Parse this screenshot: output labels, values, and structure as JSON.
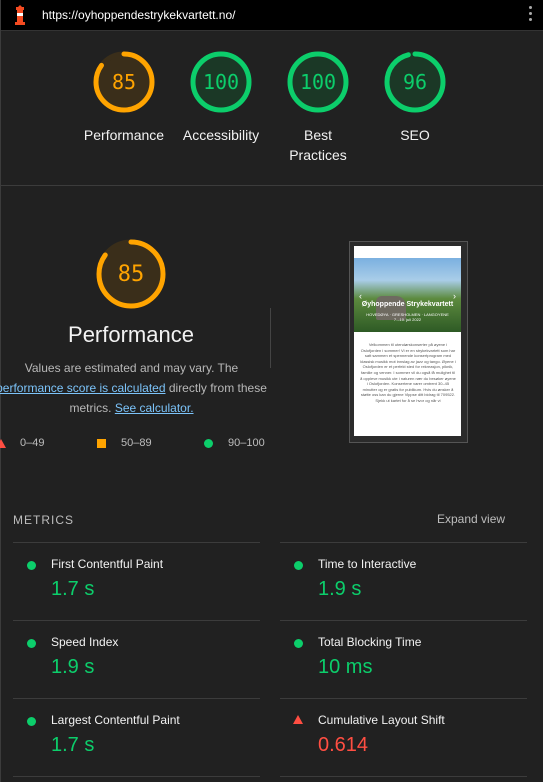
{
  "topbar": {
    "url": "https://oyhoppendestrykekvartett.no/",
    "logo_icon": "lighthouse-icon",
    "menu_icon": "kebab-menu-icon"
  },
  "colors": {
    "pass": "#0cce6b",
    "average": "#ffa400",
    "fail": "#ff4e42",
    "link": "#7cc4fa"
  },
  "summary": [
    {
      "label": "Performance",
      "score": "85",
      "score_value": 85,
      "rating": "average"
    },
    {
      "label": "Accessibility",
      "score": "100",
      "score_value": 100,
      "rating": "pass"
    },
    {
      "label": "Best\nPractices",
      "score": "100",
      "score_value": 100,
      "rating": "pass"
    },
    {
      "label": "SEO",
      "score": "96",
      "score_value": 96,
      "rating": "pass"
    }
  ],
  "performance": {
    "score": "85",
    "score_value": 85,
    "title": "Performance",
    "desc_1": "Values are estimated and may vary. The",
    "desc_link_1": "performance score is calculated",
    "desc_2": " directly from these",
    "desc_3": "metrics. ",
    "desc_link_2": "See calculator."
  },
  "legend": [
    {
      "range": "0–49",
      "shape": "triangle"
    },
    {
      "range": "50–89",
      "shape": "square"
    },
    {
      "range": "90–100",
      "shape": "circle"
    }
  ],
  "screenshot": {
    "title": "Øyhoppende Strykekvartett",
    "subtitle": "HOVEDØYA · GRESHOLMEN · LANGOYENE",
    "dates": "7.–10. juli 2022",
    "body": "Velkommen til utendørskonserter på øyene i Oslofjorden i sommer! Vi er en strykekvartett som har satt sammen et spennende konsertprogram med klassisk musikk mot innslag av jazz og tango. Øyene i Oslofjorden er et perfekt sted for rekreasjon, piknik, familie og venner. I sommer vil du også få mulighet til å oppleve musikk ute i naturen nær du besøker øyene i Oslofjorden. Konsertene varer omtrent 30–45 minutter og er gratis for publikum. Hvis du ønsker å støtte oss kan du gjerne Vippse ditt bidrag til 709522. Sjekk ut kartet for å se hvor og når vi"
  },
  "metrics": {
    "heading": "METRICS",
    "expand": "Expand view",
    "items": [
      {
        "name": "First Contentful Paint",
        "value": "1.7 s",
        "rating": "pass"
      },
      {
        "name": "Time to Interactive",
        "value": "1.9 s",
        "rating": "pass"
      },
      {
        "name": "Speed Index",
        "value": "1.9 s",
        "rating": "pass"
      },
      {
        "name": "Total Blocking Time",
        "value": "10 ms",
        "rating": "pass"
      },
      {
        "name": "Largest Contentful Paint",
        "value": "1.7 s",
        "rating": "pass"
      },
      {
        "name": "Cumulative Layout Shift",
        "value": "0.614",
        "rating": "fail"
      }
    ]
  }
}
